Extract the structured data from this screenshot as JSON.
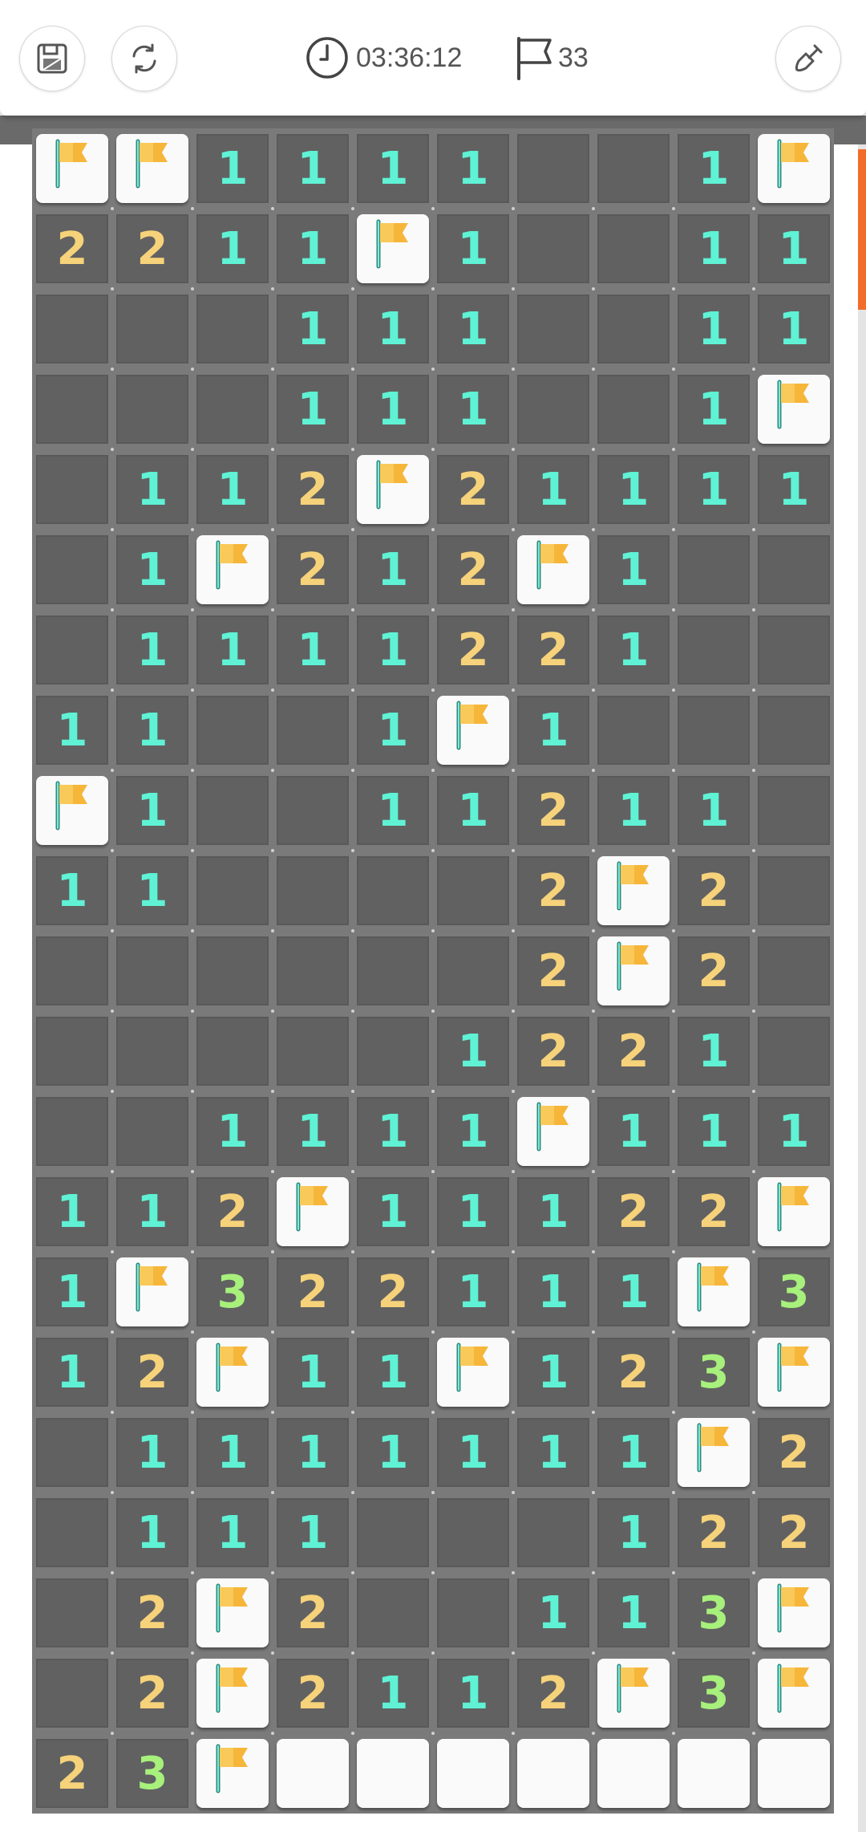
{
  "header": {
    "timer": "03:36:12",
    "flags_remaining": "33",
    "icons": {
      "save": "save-icon",
      "restart": "refresh-icon",
      "timer": "clock-icon",
      "flag": "flag-icon",
      "dig": "shovel-icon"
    }
  },
  "colors": {
    "number_1": "#5ff2d5",
    "number_2": "#f6d27a",
    "number_3": "#a7f07c",
    "revealed_cell": "#616161",
    "hidden_cell": "#fafafa",
    "flag": "#f6b63a",
    "scroll_accent": "#f26c2b"
  },
  "board": {
    "columns": 10,
    "rows": [
      [
        "F",
        "F",
        "1",
        "1",
        "1",
        "1",
        "",
        "",
        "1",
        "F"
      ],
      [
        "2",
        "2",
        "1",
        "1",
        "F",
        "1",
        "",
        "",
        "1",
        "1"
      ],
      [
        "",
        "",
        "",
        "1",
        "1",
        "1",
        "",
        "",
        "1",
        "1"
      ],
      [
        "",
        "",
        "",
        "1",
        "1",
        "1",
        "",
        "",
        "1",
        "F"
      ],
      [
        "",
        "1",
        "1",
        "2",
        "F",
        "2",
        "1",
        "1",
        "1",
        "1"
      ],
      [
        "",
        "1",
        "F",
        "2",
        "1",
        "2",
        "F",
        "1",
        "",
        ""
      ],
      [
        "",
        "1",
        "1",
        "1",
        "1",
        "2",
        "2",
        "1",
        "",
        ""
      ],
      [
        "1",
        "1",
        "",
        "",
        "1",
        "F",
        "1",
        "",
        "",
        ""
      ],
      [
        "F",
        "1",
        "",
        "",
        "1",
        "1",
        "2",
        "1",
        "1",
        ""
      ],
      [
        "1",
        "1",
        "",
        "",
        "",
        "",
        "2",
        "F",
        "2",
        ""
      ],
      [
        "",
        "",
        "",
        "",
        "",
        "",
        "2",
        "F",
        "2",
        ""
      ],
      [
        "",
        "",
        "",
        "",
        "",
        "1",
        "2",
        "2",
        "1",
        ""
      ],
      [
        "",
        "",
        "1",
        "1",
        "1",
        "1",
        "F",
        "1",
        "1",
        "1"
      ],
      [
        "1",
        "1",
        "2",
        "F",
        "1",
        "1",
        "1",
        "2",
        "2",
        "F"
      ],
      [
        "1",
        "F",
        "3",
        "2",
        "2",
        "1",
        "1",
        "1",
        "F",
        "3"
      ],
      [
        "1",
        "2",
        "F",
        "1",
        "1",
        "F",
        "1",
        "2",
        "3",
        "F"
      ],
      [
        "",
        "1",
        "1",
        "1",
        "1",
        "1",
        "1",
        "1",
        "F",
        "2"
      ],
      [
        "",
        "1",
        "1",
        "1",
        "",
        "",
        "",
        "1",
        "2",
        "2"
      ],
      [
        "",
        "2",
        "F",
        "2",
        "",
        "",
        "1",
        "1",
        "3",
        "F"
      ],
      [
        "",
        "2",
        "F",
        "2",
        "1",
        "1",
        "2",
        "F",
        "3",
        "F"
      ],
      [
        "2",
        "3",
        "F",
        "H",
        "H",
        "H",
        "H",
        "H",
        "H",
        "H"
      ]
    ]
  }
}
